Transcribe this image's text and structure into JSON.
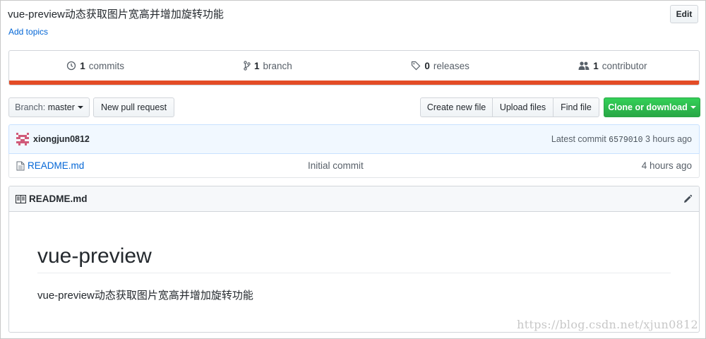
{
  "repo": {
    "description": "vue-preview动态获取图片宽高并增加旋转功能",
    "add_topics": "Add topics",
    "edit_label": "Edit"
  },
  "summary": {
    "commits_count": "1",
    "commits_label": "commits",
    "branch_count": "1",
    "branch_label": "branch",
    "releases_count": "0",
    "releases_label": "releases",
    "contributor_count": "1",
    "contributor_label": "contributor",
    "language_color": "#e34c26"
  },
  "file_nav": {
    "branch_prefix": "Branch:",
    "branch_name": "master",
    "new_pr": "New pull request",
    "create_file": "Create new file",
    "upload_files": "Upload files",
    "find_file": "Find file",
    "clone_download": "Clone or download"
  },
  "commit": {
    "author": "xiongjun0812",
    "latest_label": "Latest commit",
    "sha": "6579010",
    "age": "3 hours ago"
  },
  "files": [
    {
      "name": "README.md",
      "message": "Initial commit",
      "age": "4 hours ago",
      "icon": "file-icon"
    }
  ],
  "readme": {
    "filename": "README.md",
    "heading": "vue-preview",
    "paragraph": "vue-preview动态获取图片宽高并增加旋转功能"
  },
  "watermark": "https://blog.csdn.net/xjun0812"
}
